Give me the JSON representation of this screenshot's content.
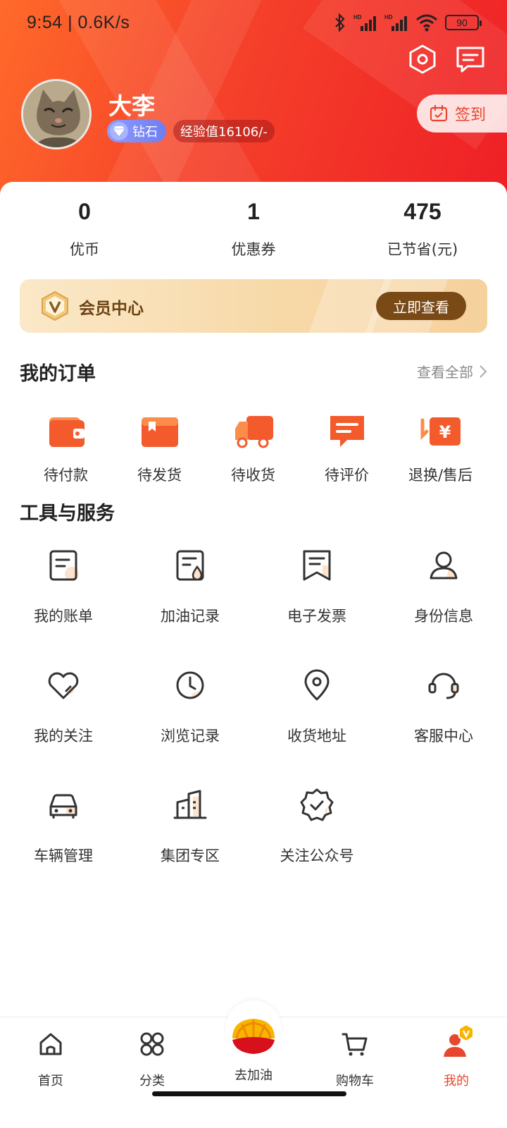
{
  "status_bar": {
    "time": "9:54 | 0.6K/s",
    "battery": "90"
  },
  "profile": {
    "name": "大李",
    "level": "钻石",
    "experience": "经验值16106/-",
    "sign_in": "签到"
  },
  "stats": [
    {
      "value": "0",
      "label": "优币"
    },
    {
      "value": "1",
      "label": "优惠券"
    },
    {
      "value": "475",
      "label": "已节省(元)"
    }
  ],
  "member": {
    "title": "会员中心",
    "button": "立即查看"
  },
  "orders": {
    "title": "我的订单",
    "see_all": "查看全部",
    "items": [
      "待付款",
      "待发货",
      "待收货",
      "待评价",
      "退换/售后"
    ]
  },
  "tools": {
    "title": "工具与服务",
    "items": [
      "我的账单",
      "加油记录",
      "电子发票",
      "身份信息",
      "我的关注",
      "浏览记录",
      "收货地址",
      "客服中心",
      "车辆管理",
      "集团专区",
      "关注公众号"
    ]
  },
  "nav": {
    "items": [
      "首页",
      "分类",
      "去加油",
      "购物车",
      "我的"
    ],
    "active": "我的"
  },
  "colors": {
    "brand_red": "#ee1f26",
    "brand_orange": "#ff6a2a",
    "accent": "#e8462e",
    "member_gold": "#7a4a16"
  }
}
